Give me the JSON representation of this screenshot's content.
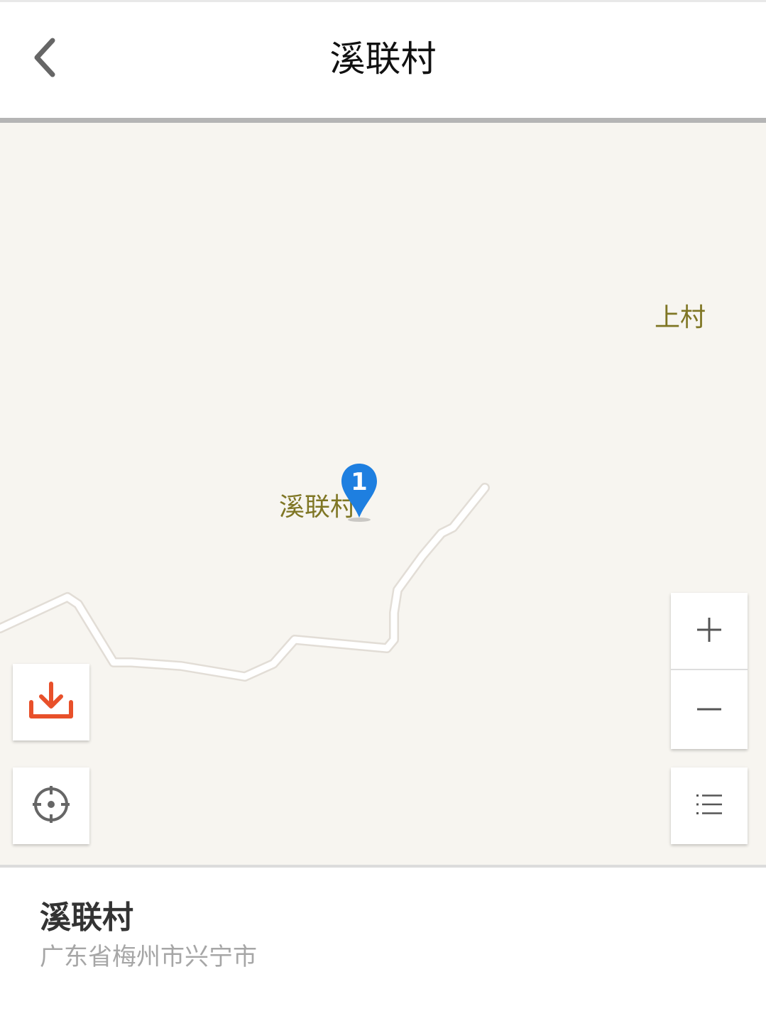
{
  "header": {
    "title": "溪联村",
    "back_icon": "chevron-left-icon"
  },
  "map": {
    "labels": [
      {
        "name": "上村"
      },
      {
        "name": "溪联村"
      }
    ],
    "marker": {
      "number": "1",
      "color": "#1e7fe0"
    },
    "controls": {
      "download_icon": "download-icon",
      "download_color": "#e8502a",
      "locate_icon": "crosshair-icon",
      "zoom_in_icon": "plus-icon",
      "zoom_out_icon": "minus-icon",
      "list_icon": "list-icon"
    }
  },
  "info": {
    "title": "溪联村",
    "address": "广东省梅州市兴宁市"
  }
}
